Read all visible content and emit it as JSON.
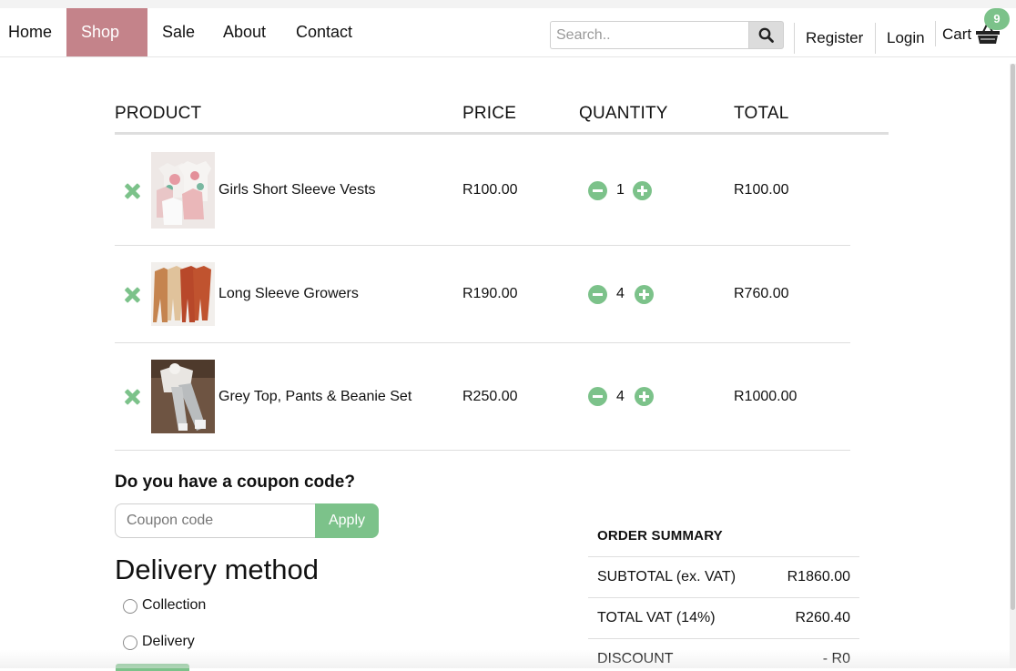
{
  "nav": {
    "items": [
      {
        "label": "Home"
      },
      {
        "label": "Shop"
      },
      {
        "label": "Sale"
      },
      {
        "label": "About"
      },
      {
        "label": "Contact"
      }
    ],
    "active_color": "#c4838a",
    "search_placeholder": "Search..",
    "register": "Register",
    "login": "Login",
    "cart_label": "Cart",
    "cart_count": "9"
  },
  "table": {
    "headers": {
      "product": "PRODUCT",
      "price": "PRICE",
      "quantity": "QUANTITY",
      "total": "TOTAL"
    },
    "rows": [
      {
        "name": "Girls Short Sleeve Vests",
        "price": "R100.00",
        "qty": "1",
        "total": "R100.00"
      },
      {
        "name": "Long Sleeve Growers",
        "price": "R190.00",
        "qty": "4",
        "total": "R760.00"
      },
      {
        "name": "Grey Top, Pants & Beanie Set",
        "price": "R250.00",
        "qty": "4",
        "total": "R1000.00"
      }
    ]
  },
  "coupon": {
    "heading": "Do you have a coupon code?",
    "placeholder": "Coupon code",
    "apply": "Apply"
  },
  "delivery": {
    "heading": "Delivery method",
    "options": [
      "Collection",
      "Delivery"
    ]
  },
  "summary": {
    "heading": "ORDER SUMMARY",
    "lines": [
      {
        "label": "SUBTOTAL (ex. VAT)",
        "value": "R1860.00"
      },
      {
        "label": "TOTAL VAT (14%)",
        "value": "R260.40"
      },
      {
        "label": "DISCOUNT",
        "value": "- R0"
      }
    ]
  },
  "accent_color": "#7cc28a"
}
